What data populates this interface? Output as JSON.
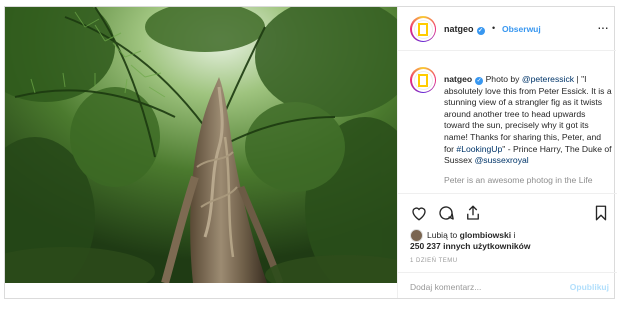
{
  "header": {
    "username": "natgeo",
    "verified_mark": "✓",
    "separator": "•",
    "follow_label": "Obserwuj",
    "more_glyph": "···",
    "avatar_logo": "yellow-rectangle-logo"
  },
  "caption": {
    "username": "natgeo",
    "text_before": "Photo by",
    "photographer": "@peteressick",
    "body": "| \"I absolutely love this from Peter Essick. It is a stunning view of a strangler fig as it twists around another tree to head upwards toward the sun, precisely why it got its name! Thanks for sharing this, Peter, and for",
    "hashtag": "#LookingUp",
    "body2": "\" - Prince Harry, The Duke of Sussex",
    "mention": "@sussexroyal",
    "truncated_line": "Peter is an awesome photog in the Life"
  },
  "actions": {
    "icons": [
      "heart-icon",
      "comment-icon",
      "share-icon",
      "bookmark-icon"
    ]
  },
  "likes": {
    "prefix": "Lubią to",
    "user": "glombiowski",
    "and": "i",
    "count_text": "250 237 innych użytkowników"
  },
  "time_label": "1 DZIEŃ TEMU",
  "comment": {
    "placeholder": "Dodaj komentarz...",
    "publish_label": "Opublikuj"
  },
  "colors": {
    "link": "#003569",
    "accent_blue": "#3897f0",
    "publish_disabled": "#b2dffc"
  }
}
